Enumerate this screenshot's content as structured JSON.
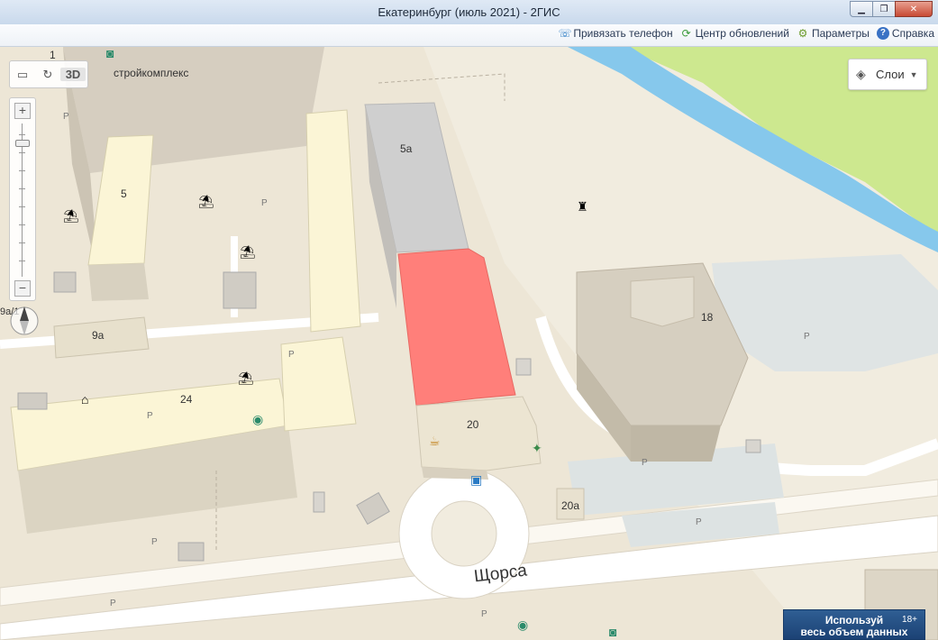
{
  "window": {
    "title": "Екатеринбург (июль 2021) - 2ГИС",
    "minimize": "▁",
    "restore": "❐",
    "close": "✕"
  },
  "toolbar": {
    "items": [
      {
        "label": "Привязать телефон",
        "icon": "phone-icon"
      },
      {
        "label": "Центр обновлений",
        "icon": "refresh-icon"
      },
      {
        "label": "Параметры",
        "icon": "gear-icon"
      },
      {
        "label": "Справка",
        "icon": "help-icon"
      }
    ]
  },
  "map": {
    "view_mode": "3D",
    "street": "Щорса",
    "top_left_label": "стройкомплекс",
    "top_left_number": "1",
    "compass_label": "9а/1",
    "highlight_color": "#ff7f7a",
    "water_color": "#86c8ec",
    "park_color": "#cde88f",
    "buildings": [
      {
        "label": "5а"
      },
      {
        "label": "5"
      },
      {
        "label": "9а"
      },
      {
        "label": "24"
      },
      {
        "label": "20"
      },
      {
        "label": "20а"
      },
      {
        "label": "18"
      }
    ],
    "parking_label": "P"
  },
  "layers": {
    "label": "Слои"
  },
  "promo": {
    "line1": "Используй",
    "line2": "весь объем данных",
    "age": "18+"
  }
}
